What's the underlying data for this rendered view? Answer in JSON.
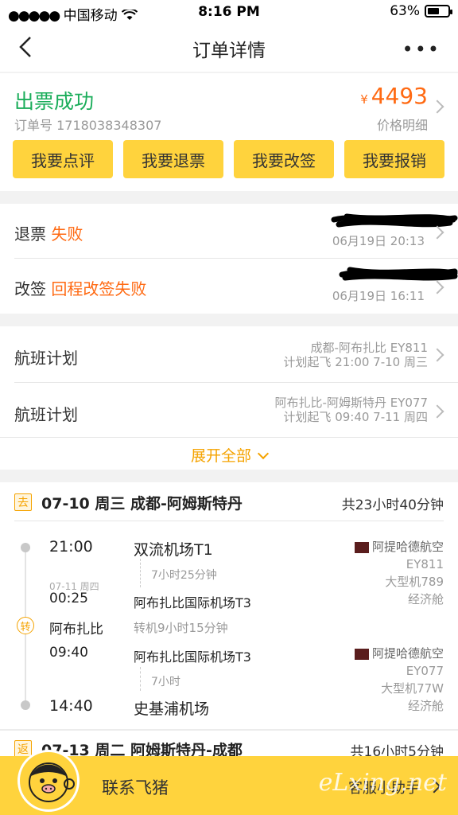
{
  "status_bar": {
    "carrier": "中国移动",
    "time": "8:16 PM",
    "battery": "63%"
  },
  "header": {
    "title": "订单详情",
    "more": "•••"
  },
  "order": {
    "status": "出票成功",
    "order_no": "订单号 1718038348307",
    "currency": "¥",
    "price": "4493",
    "price_detail": "价格明细",
    "actions": [
      "我要点评",
      "我要退票",
      "我要改签",
      "我要报销"
    ]
  },
  "records": [
    {
      "label": "退票",
      "status": "失败",
      "time": "06月19日 20:13"
    },
    {
      "label": "改签",
      "status": "回程改签失败",
      "time": "06月19日 16:11"
    }
  ],
  "plans": [
    {
      "label": "航班计划",
      "route": "成都-阿布扎比 EY811",
      "departure": "计划起飞 21:00 7-10 周三"
    },
    {
      "label": "航班计划",
      "route": "阿布扎比-阿姆斯特丹 EY077",
      "departure": "计划起飞 09:40 7-11 周四"
    }
  ],
  "expand_label": "展开全部",
  "outbound": {
    "tag": "去",
    "title": "07-10 周三 成都-阿姆斯特丹",
    "total": "共23小时40分钟",
    "leg1": {
      "dep_time": "21:00",
      "dep_airport": "双流机场T1",
      "duration": "7小时25分钟",
      "arr_date": "07-11 周四",
      "arr_time": "00:25",
      "arr_airport": "阿布扎比国际机场T3",
      "airline": "阿提哈德航空",
      "flight_no": "EY811",
      "aircraft": "大型机789",
      "cabin": "经济舱"
    },
    "transfer": {
      "tag": "转",
      "city": "阿布扎比",
      "info": "转机9小时15分钟"
    },
    "leg2": {
      "dep_time": "09:40",
      "dep_airport": "阿布扎比国际机场T3",
      "duration": "7小时",
      "arr_time": "14:40",
      "arr_airport": "史基浦机场",
      "airline": "阿提哈德航空",
      "flight_no": "EY077",
      "aircraft": "大型机77W",
      "cabin": "经济舱"
    }
  },
  "return": {
    "tag": "返",
    "title": "07-13 周二 阿姆斯特丹-成都",
    "total": "共16小时5分钟"
  },
  "bottom": {
    "contact": "联系飞猪",
    "helper": "客服小助手",
    "watermark": "eLxing.net"
  },
  "colors": {
    "accent": "#ffd33d",
    "success": "#1aad5a",
    "price": "#ff6a13",
    "link": "#f5a300"
  }
}
